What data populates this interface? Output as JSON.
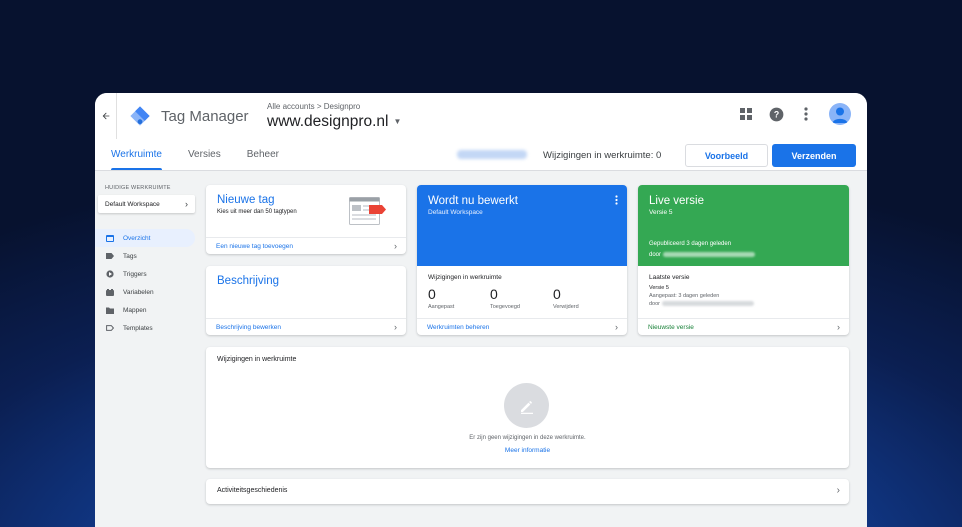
{
  "app": {
    "brand": "Tag Manager",
    "breadcrumb_accounts": "Alle accounts",
    "breadcrumb_separator": ">",
    "breadcrumb_account": "Designpro",
    "container_name": "www.designpro.nl"
  },
  "tabs": [
    {
      "label": "Werkruimte"
    },
    {
      "label": "Versies"
    },
    {
      "label": "Beheer"
    }
  ],
  "toolbar": {
    "changes_label": "Wijzigingen in werkruimte: 0",
    "preview_label": "Voorbeeld",
    "submit_label": "Verzenden"
  },
  "sidebar": {
    "workspace_label": "HUIDIGE WERKRUIMTE",
    "workspace_name": "Default Workspace",
    "items": [
      {
        "label": "Overzicht",
        "icon": "overview-icon"
      },
      {
        "label": "Tags",
        "icon": "tag-icon"
      },
      {
        "label": "Triggers",
        "icon": "trigger-icon"
      },
      {
        "label": "Variabelen",
        "icon": "variable-icon"
      },
      {
        "label": "Mappen",
        "icon": "folder-icon"
      },
      {
        "label": "Templates",
        "icon": "template-icon"
      }
    ]
  },
  "new_tag_card": {
    "title": "Nieuwe tag",
    "subtitle": "Kies uit meer dan 50 tagtypen",
    "link": "Een nieuwe tag toevoegen"
  },
  "description_card": {
    "title": "Beschrijving",
    "link": "Beschrijving bewerken"
  },
  "editing_card": {
    "title": "Wordt nu bewerkt",
    "subtitle": "Default Workspace",
    "changes_label": "Wijzigingen in werkruimte",
    "stats": [
      {
        "value": "0",
        "label": "Aangepast"
      },
      {
        "value": "0",
        "label": "Toegevoegd"
      },
      {
        "value": "0",
        "label": "Verwijderd"
      }
    ],
    "link": "Werkruimten beheren"
  },
  "live_card": {
    "title": "Live versie",
    "subtitle": "Versie 5",
    "published": "Gepubliceerd 3 dagen geleden",
    "published_by_prefix": "door",
    "latest_label": "Laatste versie",
    "latest_version": "Versie 5",
    "modified": "Aangepast: 3 dagen geleden",
    "modified_by_prefix": "door",
    "link": "Nieuwste versie"
  },
  "changes_panel": {
    "title": "Wijzigingen in werkruimte",
    "empty_text": "Er zijn geen wijzigingen in deze werkruimte.",
    "more_link": "Meer informatie"
  },
  "activity": {
    "title": "Activiteitsgeschiedenis"
  },
  "colors": {
    "primary": "#1a73e8",
    "live_green": "#34a853",
    "page_bg": "#f1f3f4"
  }
}
